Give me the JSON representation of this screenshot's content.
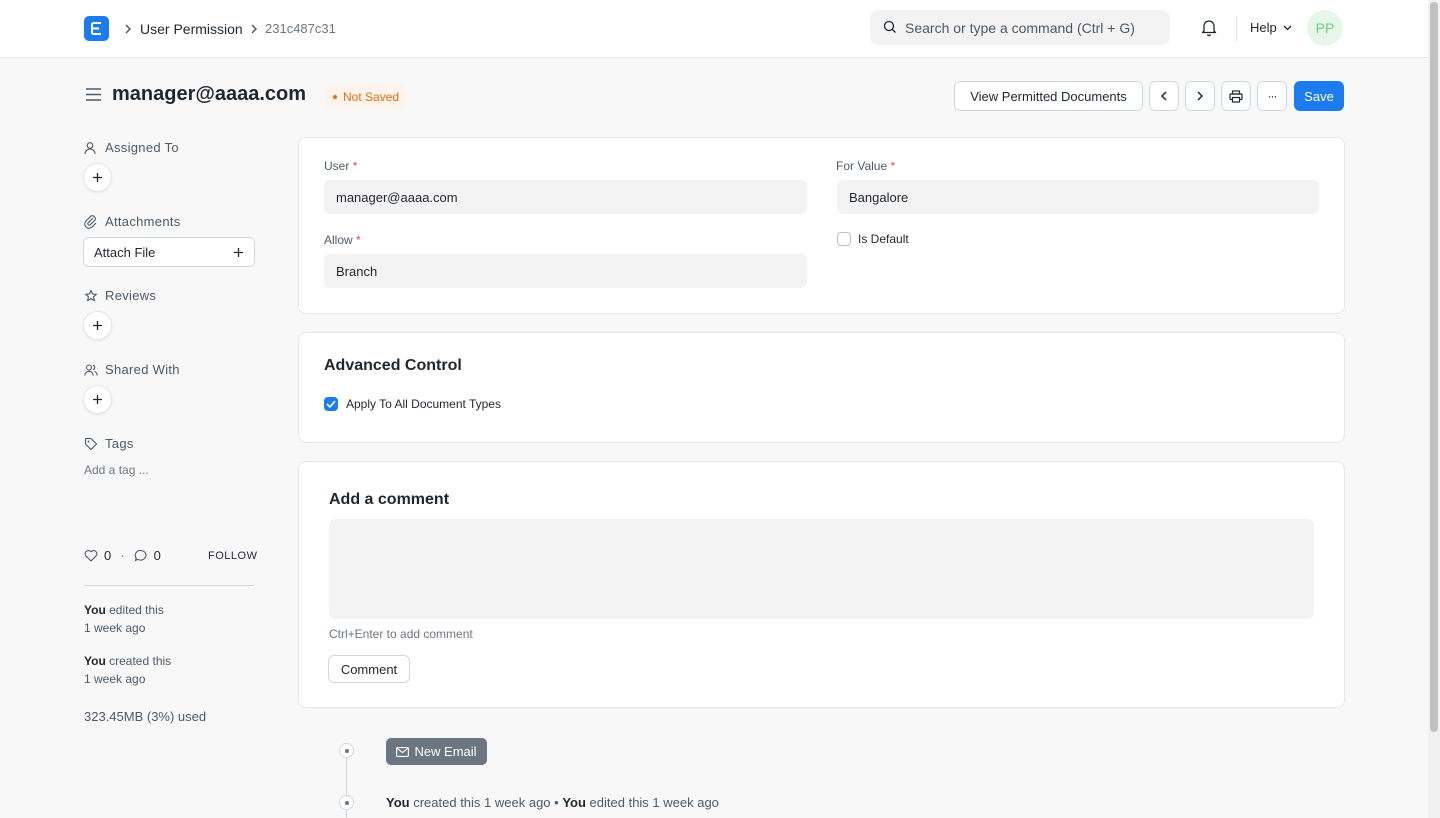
{
  "navbar": {
    "breadcrumbs": [
      "User Permission",
      "231c487c31"
    ],
    "search_placeholder": "Search or type a command (Ctrl + G)",
    "help_label": "Help",
    "avatar_initials": "PP"
  },
  "header": {
    "title": "manager@aaaa.com",
    "status": "Not Saved",
    "view_docs_label": "View Permitted Documents",
    "more_label": "···",
    "save_label": "Save"
  },
  "sidebar": {
    "assigned_to": "Assigned To",
    "attachments": "Attachments",
    "attach_file": "Attach File",
    "reviews": "Reviews",
    "shared_with": "Shared With",
    "tags": "Tags",
    "add_tag": "Add a tag ...",
    "likes": "0",
    "comments_count": "0",
    "follow": "FOLLOW",
    "activity": [
      {
        "who": "You",
        "action": "edited this",
        "when": "1 week ago"
      },
      {
        "who": "You",
        "action": "created this",
        "when": "1 week ago"
      }
    ],
    "storage": "323.45MB (3%) used"
  },
  "form": {
    "user_label": "User",
    "user_value": "manager@aaaa.com",
    "for_value_label": "For Value",
    "for_value_value": "Bangalore",
    "allow_label": "Allow",
    "allow_value": "Branch",
    "is_default_label": "Is Default",
    "required_mark": "*"
  },
  "advanced": {
    "title": "Advanced Control",
    "apply_all_label": "Apply To All Document Types"
  },
  "comment": {
    "title": "Add a comment",
    "hint": "Ctrl+Enter to add comment",
    "button": "Comment"
  },
  "timeline": {
    "new_email": "New Email",
    "entry_who1": "You",
    "entry_action1": "created this 1 week ago •",
    "entry_who2": "You",
    "entry_action2": "edited this 1 week ago"
  }
}
